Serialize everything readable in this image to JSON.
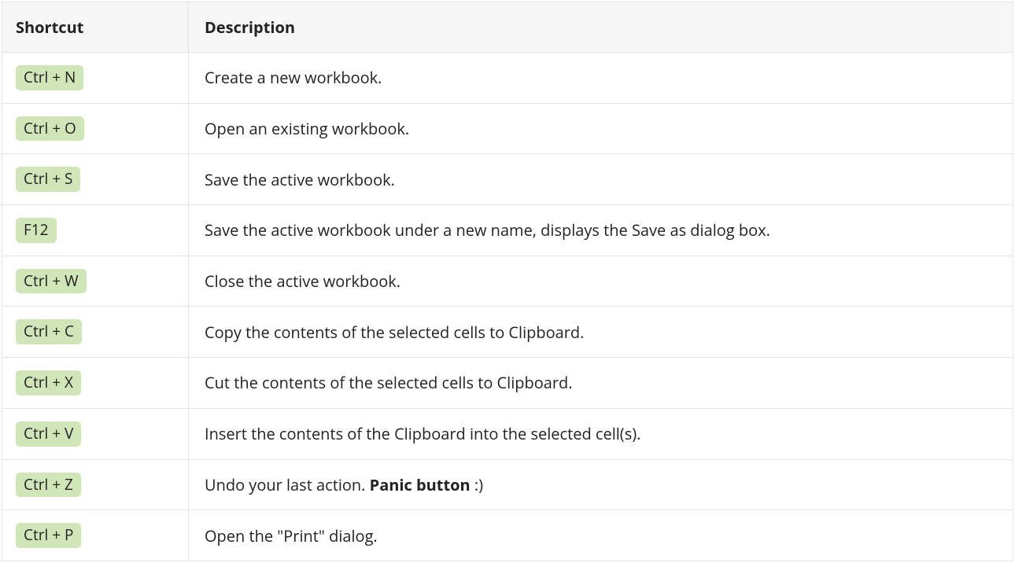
{
  "headers": {
    "shortcut": "Shortcut",
    "description": "Description"
  },
  "rows": [
    {
      "key": "Ctrl + N",
      "desc_pre": "Create a new workbook.",
      "desc_bold": "",
      "desc_post": ""
    },
    {
      "key": "Ctrl + O",
      "desc_pre": "Open an existing workbook.",
      "desc_bold": "",
      "desc_post": ""
    },
    {
      "key": "Ctrl + S",
      "desc_pre": "Save the active workbook.",
      "desc_bold": "",
      "desc_post": ""
    },
    {
      "key": "F12",
      "desc_pre": "Save the active workbook under a new name, displays the Save as dialog box.",
      "desc_bold": "",
      "desc_post": ""
    },
    {
      "key": "Ctrl + W",
      "desc_pre": "Close the active workbook.",
      "desc_bold": "",
      "desc_post": ""
    },
    {
      "key": "Ctrl + C",
      "desc_pre": "Copy the contents of the selected cells to Clipboard.",
      "desc_bold": "",
      "desc_post": ""
    },
    {
      "key": "Ctrl + X",
      "desc_pre": "Cut the contents of the selected cells to Clipboard.",
      "desc_bold": "",
      "desc_post": ""
    },
    {
      "key": "Ctrl + V",
      "desc_pre": "Insert the contents of the Clipboard into the selected cell(s).",
      "desc_bold": "",
      "desc_post": ""
    },
    {
      "key": "Ctrl + Z",
      "desc_pre": "Undo your last action. ",
      "desc_bold": "Panic button",
      "desc_post": " :)"
    },
    {
      "key": "Ctrl + P",
      "desc_pre": "Open the \"Print\" dialog.",
      "desc_bold": "",
      "desc_post": ""
    }
  ]
}
